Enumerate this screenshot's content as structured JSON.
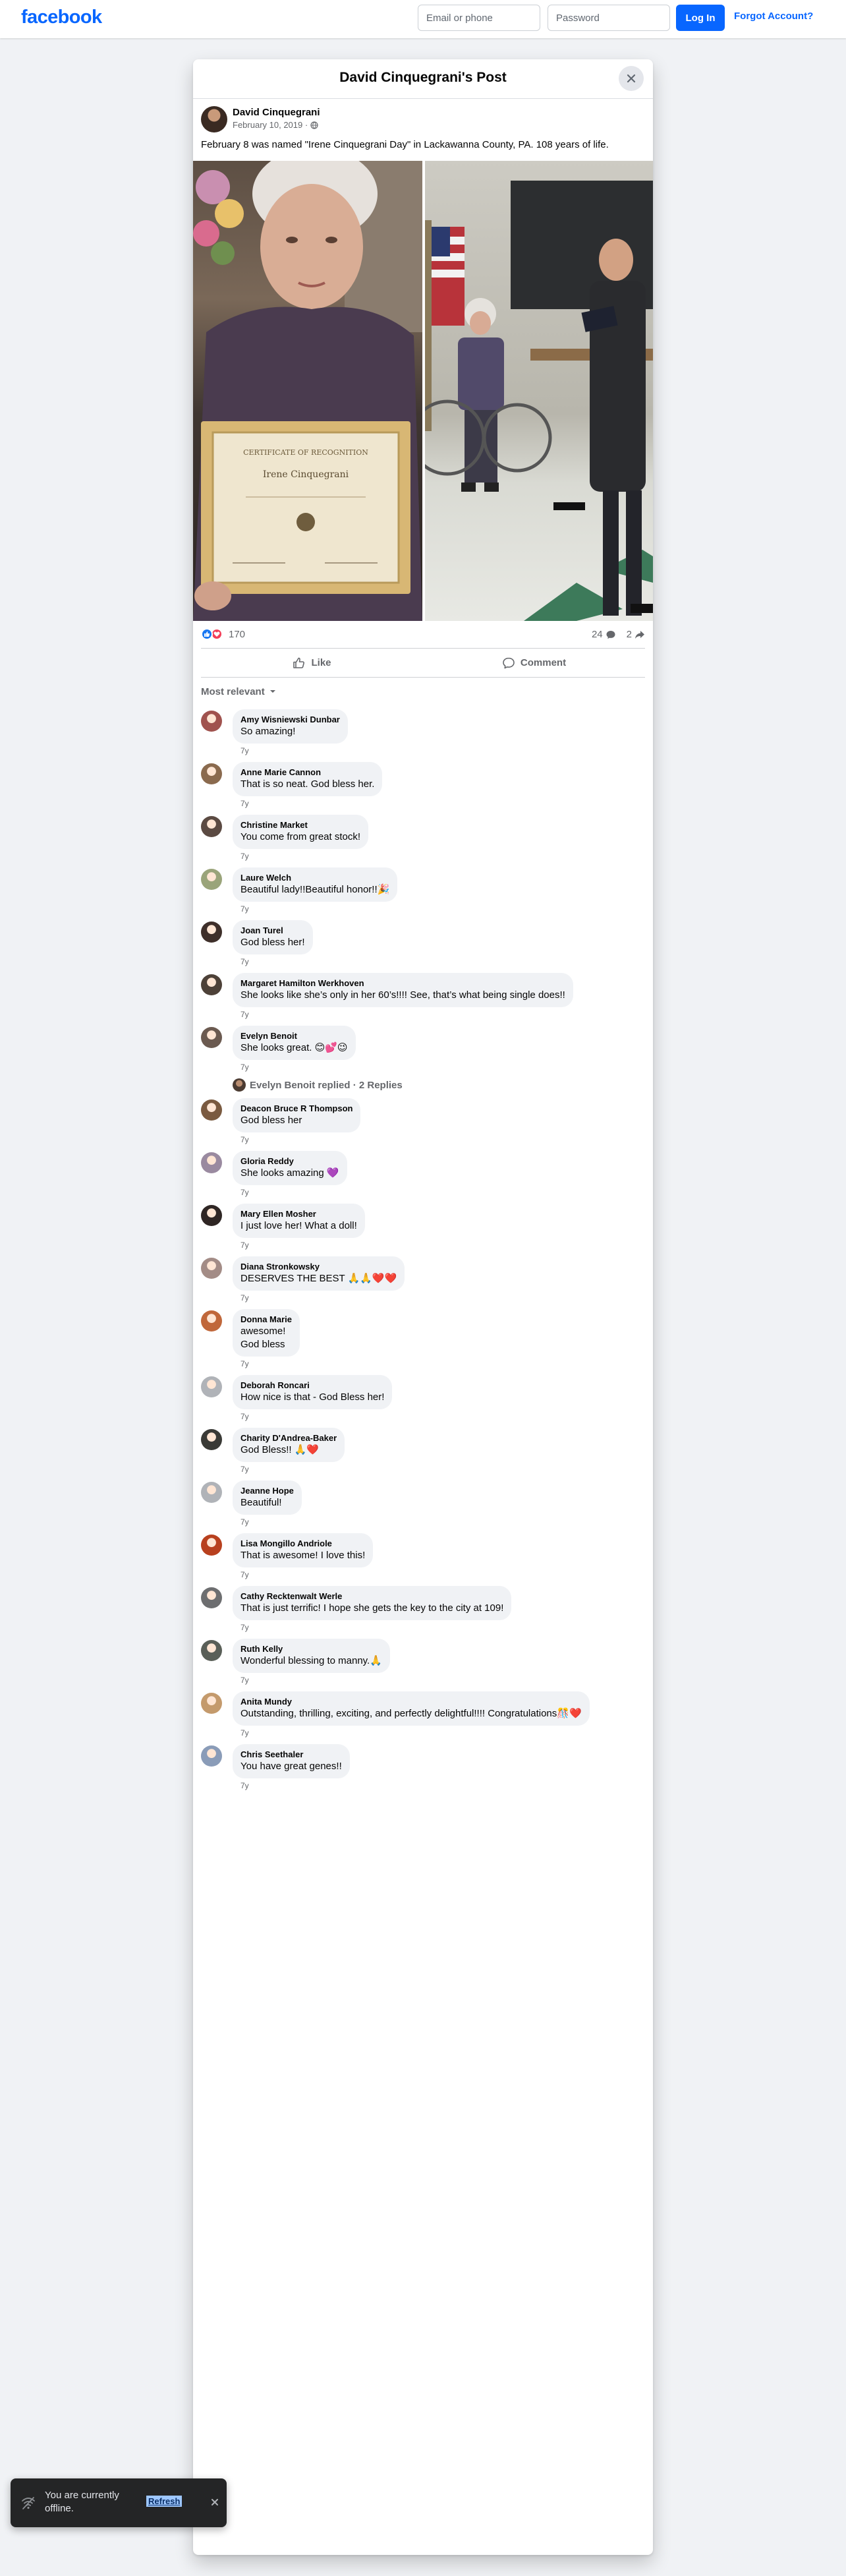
{
  "header": {
    "logo": "facebook",
    "email_placeholder": "Email or phone",
    "password_placeholder": "Password",
    "login_label": "Log In",
    "forgot_label": "Forgot Account?"
  },
  "dialog": {
    "title": "David Cinquegrani's Post"
  },
  "post": {
    "author": "David Cinquegrani",
    "date": "February 10, 2019 ·",
    "text": "February 8 was named \"Irene Cinquegrani Day\" in Lackawanna County, PA. 108 years of life.",
    "certificate_title": "CERTIFICATE OF RECOGNITION",
    "certificate_name": "Irene Cinquegrani",
    "reaction_count": "170",
    "comment_count": "24",
    "share_count": "2",
    "like_label": "Like",
    "comment_label": "Comment",
    "sort_label": "Most relevant"
  },
  "comments": [
    {
      "name": "Amy Wisniewski Dunbar",
      "text": "So amazing!",
      "time": "7y",
      "avatar_color": "#a0524e"
    },
    {
      "name": "Anne Marie Cannon",
      "text": "That is so neat. God bless her.",
      "time": "7y",
      "avatar_color": "#8a6a4e"
    },
    {
      "name": "Christine Market",
      "text": "You come from great stock!",
      "time": "7y",
      "avatar_color": "#5b4a42"
    },
    {
      "name": "Laure Welch",
      "text": "Beautiful lady!!Beautiful honor!!🎉",
      "time": "7y",
      "avatar_color": "#9aa47a"
    },
    {
      "name": "Joan Turel",
      "text": "God bless her!",
      "time": "7y",
      "avatar_color": "#3e2f2a"
    },
    {
      "name": "Margaret Hamilton Werkhoven",
      "text": "She looks like she’s only in her 60’s!!!! See, that’s what being single does!!",
      "time": "7y",
      "avatar_color": "#4d4138"
    },
    {
      "name": "Evelyn Benoit",
      "text": "She looks great. 😊💕😉",
      "time": "7y",
      "avatar_color": "#6b5a50"
    },
    {
      "name": "Deacon Bruce R Thompson",
      "text": "God bless her",
      "time": "7y",
      "avatar_color": "#7a5a40"
    },
    {
      "name": "Gloria Reddy",
      "text": "She looks amazing 💜",
      "time": "7y",
      "avatar_color": "#9a8aa0"
    },
    {
      "name": "Mary Ellen Mosher",
      "text": "I just love her! What a doll!",
      "time": "7y",
      "avatar_color": "#2f2624"
    },
    {
      "name": "Diana Stronkowsky",
      "text": "DESERVES THE BEST 🙏🙏❤️❤️",
      "time": "7y",
      "avatar_color": "#a38c86"
    },
    {
      "name": "Donna Marie",
      "text": "awesome!\nGod bless",
      "time": "7y",
      "avatar_color": "#c0673a"
    },
    {
      "name": "Deborah Roncari",
      "text": "How nice is that - God Bless her!",
      "time": "7y",
      "avatar_color": "#b0b3b8"
    },
    {
      "name": "Charity D'Andrea-Baker",
      "text": "God Bless!! 🙏❤️",
      "time": "7y",
      "avatar_color": "#3a3a36"
    },
    {
      "name": "Jeanne Hope",
      "text": "Beautiful!",
      "time": "7y",
      "avatar_color": "#b0b3b8"
    },
    {
      "name": "Lisa Mongillo Andriole",
      "text": "That is awesome! I love this!",
      "time": "7y",
      "avatar_color": "#b8401e"
    },
    {
      "name": "Cathy Recktenwalt Werle",
      "text": "That is just terrific! I hope she gets the key to the city at 109!",
      "time": "7y",
      "avatar_color": "#6d6e70"
    },
    {
      "name": "Ruth Kelly",
      "text": "Wonderful blessing to manny.🙏",
      "time": "7y",
      "avatar_color": "#5a5f58"
    },
    {
      "name": "Anita Mundy",
      "text": "Outstanding, thrilling, exciting, and perfectly delightful!!!! Congratulations🎊❤️",
      "time": "7y",
      "avatar_color": "#c49a6c"
    },
    {
      "name": "Chris Seethaler",
      "text": "You have great genes!!",
      "time": "7y",
      "avatar_color": "#8a9cb8"
    }
  ],
  "evelyn_replies": {
    "label": "Evelyn Benoit replied · 2 Replies"
  },
  "toast": {
    "text": "You are currently offline.",
    "refresh_label": "Refresh"
  }
}
